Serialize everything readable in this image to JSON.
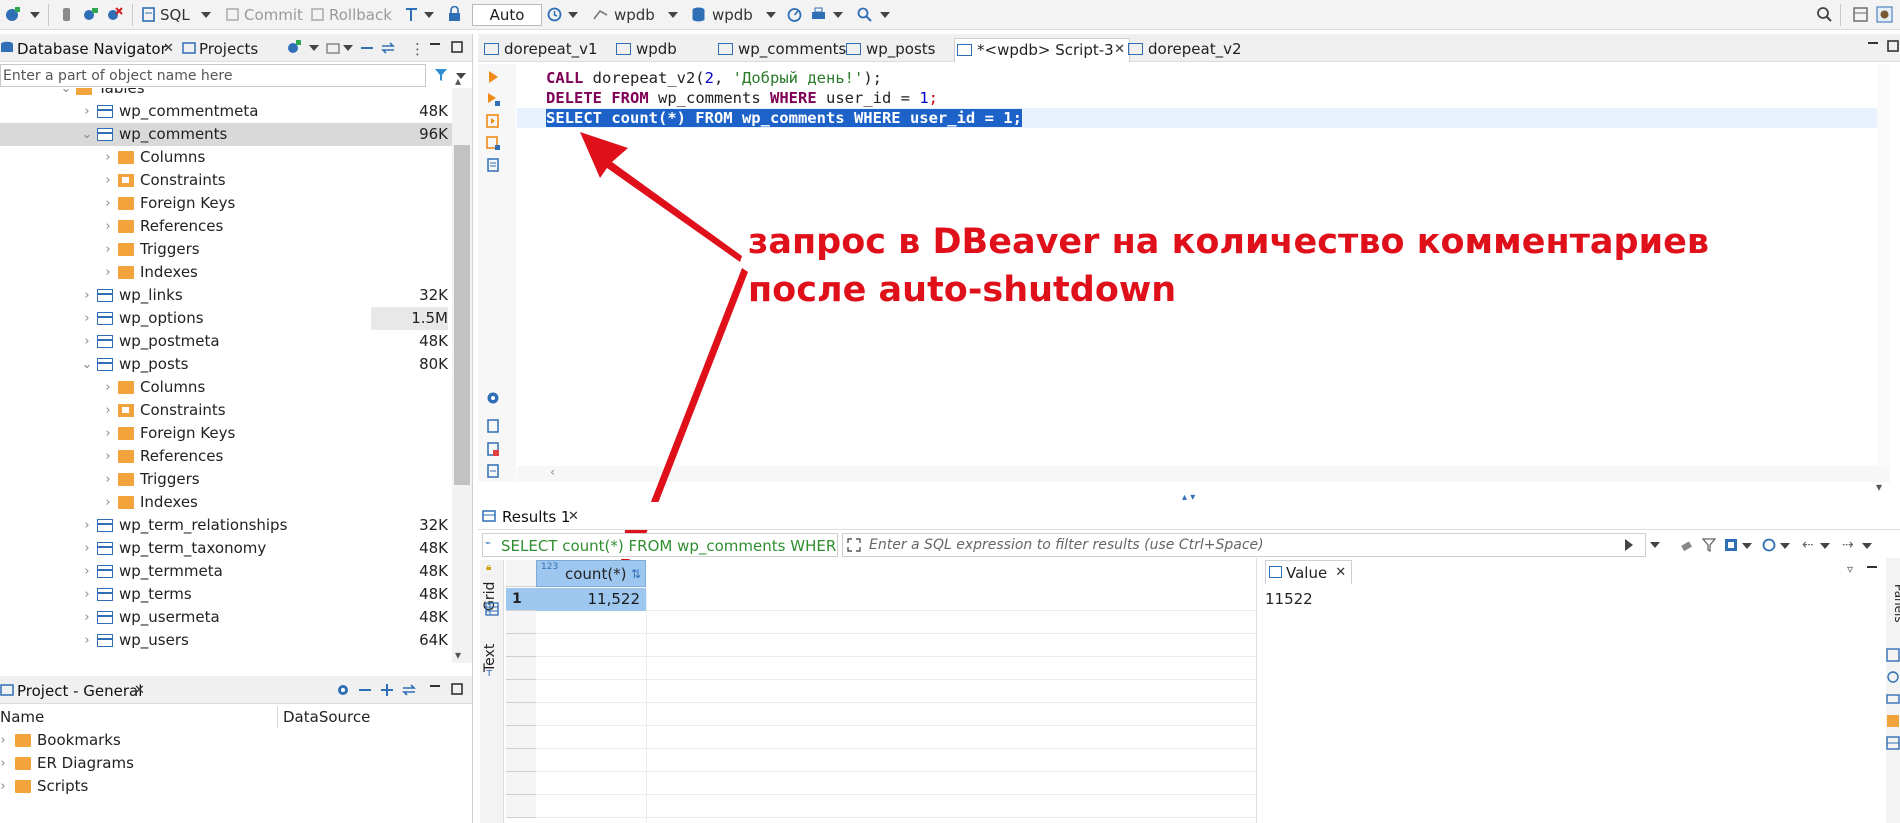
{
  "toolbar": {
    "sql_label": "SQL",
    "commit_label": "Commit",
    "rollback_label": "Rollback",
    "tx_mode": "Auto",
    "datasource_label": "wpdb",
    "schema_label": "wpdb"
  },
  "navigator": {
    "tab_db": "Database Navigator",
    "tab_projects": "Projects",
    "search_placeholder": "Enter a part of object name here",
    "tree": [
      {
        "label": "Tables",
        "type": "folder-open",
        "level": 0,
        "expanded": true,
        "size": ""
      },
      {
        "label": "wp_commentmeta",
        "type": "table",
        "level": 1,
        "expanded": false,
        "size": "48K"
      },
      {
        "label": "wp_comments",
        "type": "table",
        "level": 1,
        "expanded": true,
        "size": "96K",
        "selected": true
      },
      {
        "label": "Columns",
        "type": "folder",
        "level": 2,
        "expanded": false,
        "size": ""
      },
      {
        "label": "Constraints",
        "type": "constraint",
        "level": 2,
        "expanded": false,
        "size": ""
      },
      {
        "label": "Foreign Keys",
        "type": "folder",
        "level": 2,
        "expanded": false,
        "size": ""
      },
      {
        "label": "References",
        "type": "folder",
        "level": 2,
        "expanded": false,
        "size": ""
      },
      {
        "label": "Triggers",
        "type": "folder",
        "level": 2,
        "expanded": false,
        "size": ""
      },
      {
        "label": "Indexes",
        "type": "folder",
        "level": 2,
        "expanded": false,
        "size": ""
      },
      {
        "label": "wp_links",
        "type": "table",
        "level": 1,
        "expanded": false,
        "size": "32K"
      },
      {
        "label": "wp_options",
        "type": "table",
        "level": 1,
        "expanded": false,
        "size": "1.5M",
        "size_hl": true
      },
      {
        "label": "wp_postmeta",
        "type": "table",
        "level": 1,
        "expanded": false,
        "size": "48K"
      },
      {
        "label": "wp_posts",
        "type": "table",
        "level": 1,
        "expanded": true,
        "size": "80K"
      },
      {
        "label": "Columns",
        "type": "folder",
        "level": 2,
        "expanded": false,
        "size": ""
      },
      {
        "label": "Constraints",
        "type": "constraint",
        "level": 2,
        "expanded": false,
        "size": ""
      },
      {
        "label": "Foreign Keys",
        "type": "folder",
        "level": 2,
        "expanded": false,
        "size": ""
      },
      {
        "label": "References",
        "type": "folder",
        "level": 2,
        "expanded": false,
        "size": ""
      },
      {
        "label": "Triggers",
        "type": "folder",
        "level": 2,
        "expanded": false,
        "size": ""
      },
      {
        "label": "Indexes",
        "type": "folder",
        "level": 2,
        "expanded": false,
        "size": ""
      },
      {
        "label": "wp_term_relationships",
        "type": "table",
        "level": 1,
        "expanded": false,
        "size": "32K"
      },
      {
        "label": "wp_term_taxonomy",
        "type": "table",
        "level": 1,
        "expanded": false,
        "size": "48K"
      },
      {
        "label": "wp_termmeta",
        "type": "table",
        "level": 1,
        "expanded": false,
        "size": "48K"
      },
      {
        "label": "wp_terms",
        "type": "table",
        "level": 1,
        "expanded": false,
        "size": "48K"
      },
      {
        "label": "wp_usermeta",
        "type": "table",
        "level": 1,
        "expanded": false,
        "size": "48K"
      },
      {
        "label": "wp_users",
        "type": "table",
        "level": 1,
        "expanded": false,
        "size": "64K"
      }
    ]
  },
  "project": {
    "tab_label": "Project - General",
    "col_name": "Name",
    "col_datasource": "DataSource",
    "items": [
      {
        "label": "Bookmarks"
      },
      {
        "label": "ER Diagrams"
      },
      {
        "label": "Scripts"
      }
    ]
  },
  "editor": {
    "tabs": [
      {
        "label": "dorepeat_v1"
      },
      {
        "label": "wpdb"
      },
      {
        "label": "wp_comments"
      },
      {
        "label": "wp_posts"
      },
      {
        "label": "*<wpdb> Script-3",
        "active": true
      },
      {
        "label": "dorepeat_v2"
      }
    ],
    "line1": {
      "kw": "CALL",
      "rest_a": " dorepeat_v2(",
      "num": "2",
      "rest_b": ", ",
      "str": "'Добрый день!'",
      "rest_c": ");"
    },
    "line2": {
      "kw1": "DELETE",
      "kw2": "FROM",
      "mid": " wp_comments ",
      "kw3": "WHERE",
      "rest": " user_id = ",
      "num": "1",
      "end": ";"
    },
    "line3": "SELECT count(*) FROM wp_comments WHERE user_id = 1;"
  },
  "annotation": {
    "line1": "запрос в DBeaver на количество комментариев",
    "line2": "после auto-shutdown"
  },
  "results": {
    "tab_label": "Results 1",
    "sql_chip": "SELECT count(*) FROM wp_comments WHERE user",
    "filter_placeholder": "Enter a SQL expression to filter results (use Ctrl+Space)",
    "side_tab_grid": "Grid",
    "side_tab_text": "Text",
    "column_header": "count(*)",
    "column_type_badge": "123",
    "rows": [
      {
        "num": "1",
        "value": "11,522"
      }
    ],
    "value_panel_tab": "Value",
    "value_panel_text": "11522",
    "panels_label": "Panels"
  },
  "colors": {
    "accent": "#2f6fb6",
    "folder": "#f3a33c",
    "annotation": "#e0101a",
    "selection": "#1c62c9"
  }
}
